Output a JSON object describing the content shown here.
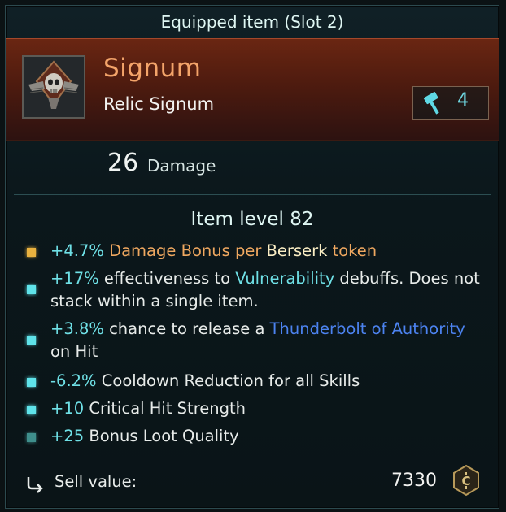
{
  "tooltip": {
    "title": "Equipped item (Slot 2)",
    "item_name": "Signum",
    "item_type": "Relic Signum",
    "power_level": "4",
    "item_icon": "skull-winged-signum-icon",
    "damage": {
      "value": "26",
      "label": "Damage"
    },
    "item_level": "Item level 82",
    "affixes": [
      {
        "bullet_color": "#e8b13f",
        "parts": [
          {
            "text": "+4.7%",
            "color": "cyan"
          },
          {
            "text": " Damage Bonus per ",
            "color": "orange"
          },
          {
            "text": "Berserk",
            "color": "cream"
          },
          {
            "text": " token",
            "color": "orange"
          }
        ]
      },
      {
        "bullet_color": "#5fe3ea",
        "parts": [
          {
            "text": "+17%",
            "color": "cyan"
          },
          {
            "text": " effectiveness to ",
            "color": "white"
          },
          {
            "text": "Vulnerability",
            "color": "cyan"
          },
          {
            "text": " debuffs. Does not stack within a single item.",
            "color": "white"
          }
        ]
      },
      {
        "bullet_color": "#5fe3ea",
        "parts": [
          {
            "text": "+3.8%",
            "color": "cyan"
          },
          {
            "text": " chance to release a ",
            "color": "white"
          },
          {
            "text": "Thunderbolt of Authority",
            "color": "blue"
          },
          {
            "text": " on Hit",
            "color": "white"
          }
        ]
      },
      {
        "bullet_color": "#5fe3ea",
        "parts": [
          {
            "text": "-6.2%",
            "color": "cyan"
          },
          {
            "text": " Cooldown Reduction for all Skills",
            "color": "white"
          }
        ]
      },
      {
        "bullet_color": "#5fe3ea",
        "parts": [
          {
            "text": "+10",
            "color": "cyan"
          },
          {
            "text": " Critical Hit Strength",
            "color": "white"
          }
        ]
      },
      {
        "bullet_color": "#3f8f8c",
        "parts": [
          {
            "text": "+25",
            "color": "cyan"
          },
          {
            "text": " Bonus Loot Quality",
            "color": "white"
          }
        ]
      }
    ],
    "sell": {
      "label": "Sell value:",
      "value": "7330"
    }
  }
}
